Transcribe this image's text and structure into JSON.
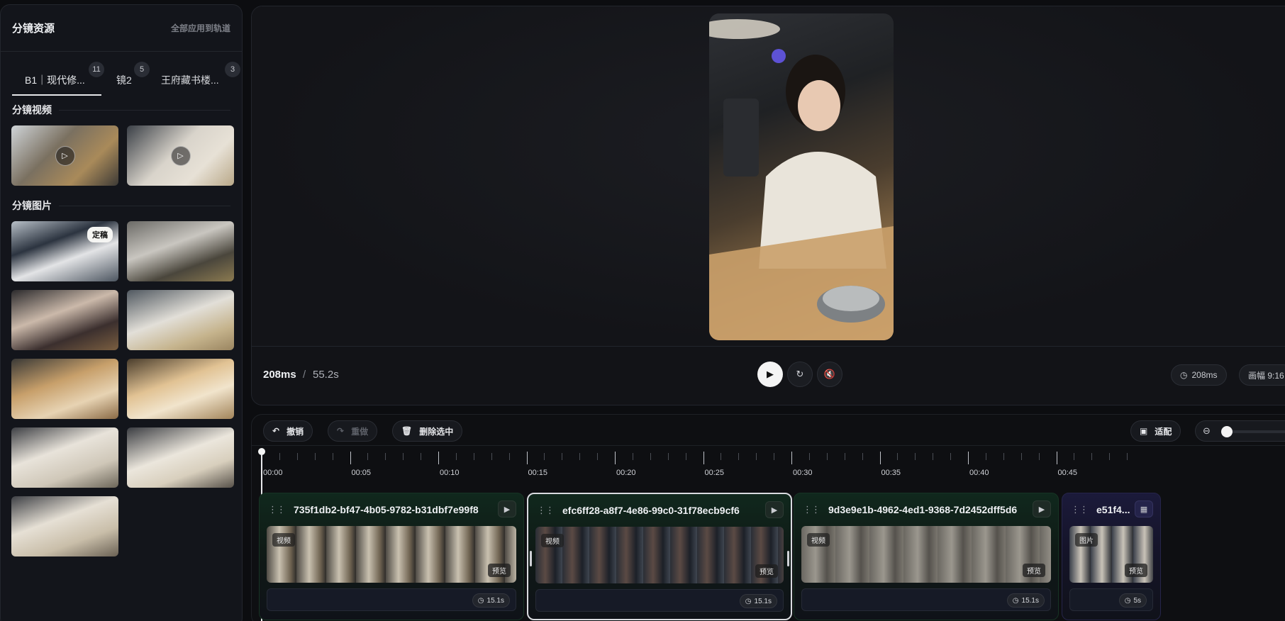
{
  "sidebar": {
    "title": "分镜资源",
    "apply_all": "全部应用到轨道",
    "tabs": [
      {
        "label": "B1｜现代修...",
        "count": "11"
      },
      {
        "label": "镜2",
        "count": "5"
      },
      {
        "label": "王府藏书楼...",
        "count": "3"
      }
    ],
    "videos_title": "分镜视频",
    "images_title": "分镜图片",
    "final_badge": "定稿"
  },
  "preview": {
    "current_time": "208ms",
    "separator": "/",
    "total_time": "55.2s",
    "duration_pill": "208ms",
    "ratio_pill": "画幅 9:16"
  },
  "toolbar": {
    "undo": "撤销",
    "redo": "重做",
    "delete_selected": "删除选中",
    "fit": "适配"
  },
  "ruler": {
    "labels": [
      "00:00",
      "00:05",
      "00:10",
      "00:15",
      "00:20",
      "00:25",
      "00:30",
      "00:35",
      "00:40",
      "00:45"
    ]
  },
  "clips": [
    {
      "name": "735f1db2-bf47-4b05-9782-b31dbf7e99f8",
      "type": "视频",
      "preview": "预览",
      "duration": "15.1s"
    },
    {
      "name": "efc6ff28-a8f7-4e86-99c0-31f78ecb9cf6",
      "type": "视频",
      "preview": "预览",
      "duration": "15.1s"
    },
    {
      "name": "9d3e9e1b-4962-4ed1-9368-7d2452dff5d6",
      "type": "视频",
      "preview": "预览",
      "duration": "15.1s"
    },
    {
      "name": "e51f4...",
      "type": "图片",
      "preview": "预览",
      "duration": "5s"
    }
  ],
  "colors": {
    "accent_green": "#10281d",
    "accent_purple": "#1b1a3a",
    "background": "#0c0d10"
  },
  "icons": {
    "undo": "undo-icon",
    "redo": "redo-icon",
    "delete": "trash-icon",
    "fit": "fit-frame-icon",
    "play": "play-icon",
    "replay": "replay-icon",
    "mute": "mute-icon",
    "clock": "clock-icon",
    "zoom_out": "zoom-out-icon"
  }
}
